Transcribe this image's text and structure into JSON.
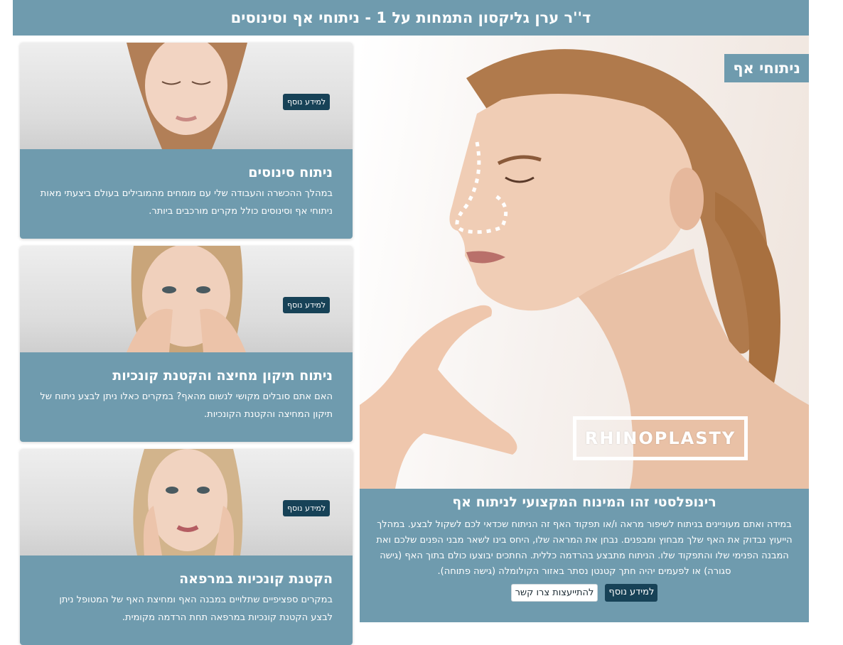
{
  "header": {
    "title": "ד''ר ערן גליקסון התמחות על 1 - ניתוחי אף וסינוסים"
  },
  "hero": {
    "tag": "ניתוחי אף",
    "overlay_text": "RHINOPLASTY",
    "heading": "רינופלסטי זהו המינוח המקצועי לניתוח אף",
    "paragraph": "במידה ואתם מעוניינים בניתוח לשיפור מראה ו/או תפקוד האף זה הניתוח שכדאי לכם לשקול לבצע. במהלך הייעוץ נבדוק את האף שלך מבחוץ ומבפנים. נבחן את המראה שלו, היחס בינו לשאר מבני הפנים שלכם ואת המבנה הפנימי שלו והתפקוד שלו. הניתוח מתבצע בהרדמה כללית. החתכים יבוצעו כולם בתוך האף (גישה סגורה) או לפעמים יהיה חתך קטנטן נסתר באזור הקולומלה (גישה פתוחה).",
    "more_button": "למידע נוסף",
    "contact_button": "להתייעצות צרו קשר"
  },
  "cards": [
    {
      "title": "ניתוח סינוסים",
      "text": "במהלך ההכשרה והעבודה שלי עם מומחים מהמובילים בעולם ביצעתי מאות ניתוחי אף וסינוסים כולל מקרים מורכבים ביותר.",
      "button": "למידע נוסף"
    },
    {
      "title": "ניתוח תיקון מחיצה והקטנת קונכיות",
      "text": "האם אתם סובלים מקושי לנשום מהאף? במקרים כאלו ניתן לבצע ניתוח של תיקון המחיצה והקטנת הקונכיות.",
      "button": "למידע נוסף"
    },
    {
      "title": "הקטנת קונכיות במרפאה",
      "text": "במקרים ספציפיים שתלויים במבנה האף ומחיצת האף של המטופל ניתן לבצע הקטנת קונכיות במרפאה תחת הרדמה מקומית.",
      "button": "למידע נוסף"
    }
  ],
  "colors": {
    "accent": "#6f9bae",
    "button_dark": "#174257"
  }
}
